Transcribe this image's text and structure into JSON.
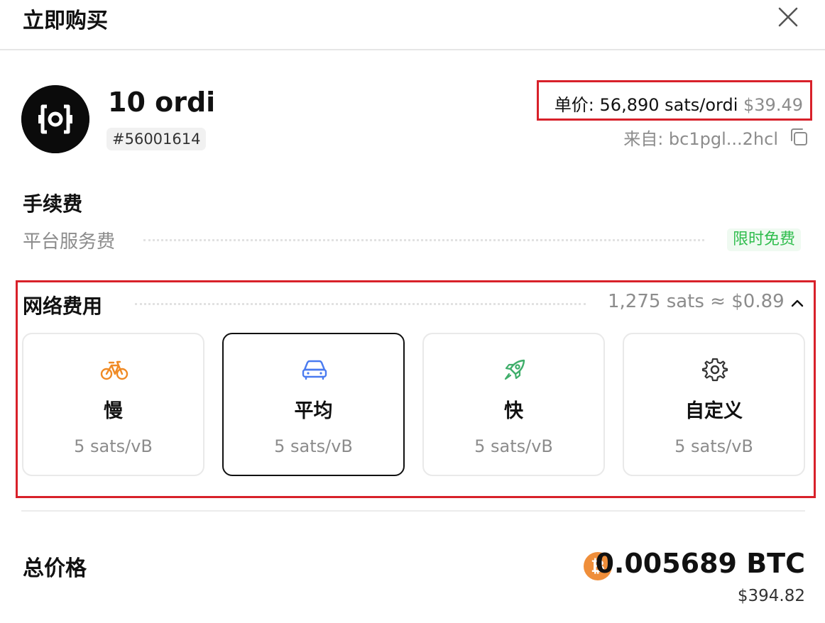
{
  "header": {
    "title": "立即购买",
    "close_icon": "close-icon"
  },
  "token": {
    "logo_icon": "ordi-logo-icon",
    "name": "10 ordi",
    "id": "#56001614",
    "unit_price_label": "单价: 56,890 sats/ordi",
    "unit_price_usd": "$39.49",
    "from_label": "来自: bc1pgl...2hcl",
    "copy_icon": "copy-icon"
  },
  "fees": {
    "title": "手续费",
    "platform_label": "平台服务费",
    "platform_value": "限时免费"
  },
  "network": {
    "title": "网络费用",
    "total": "1,275 sats ≈ $0.89",
    "collapse_icon": "chevron-up-icon",
    "options": [
      {
        "label": "慢",
        "rate": "5 sats/vB",
        "icon": "bicycle-icon",
        "color": "#f08a24",
        "selected": false
      },
      {
        "label": "平均",
        "rate": "5 sats/vB",
        "icon": "car-icon",
        "color": "#4a7bf0",
        "selected": true
      },
      {
        "label": "快",
        "rate": "5 sats/vB",
        "icon": "rocket-icon",
        "color": "#3fae6a",
        "selected": false
      },
      {
        "label": "自定义",
        "rate": "5 sats/vB",
        "icon": "gear-icon",
        "color": "#333333",
        "selected": false
      }
    ]
  },
  "total": {
    "label": "总价格",
    "btc_icon": "bitcoin-icon",
    "btc": "0.005689 BTC",
    "usd": "$394.82"
  },
  "colors": {
    "highlight_border": "#d8212a",
    "free_green": "#2fbd4d",
    "bitcoin_orange": "#ef8e3a",
    "muted_text": "#8c8c8c"
  }
}
